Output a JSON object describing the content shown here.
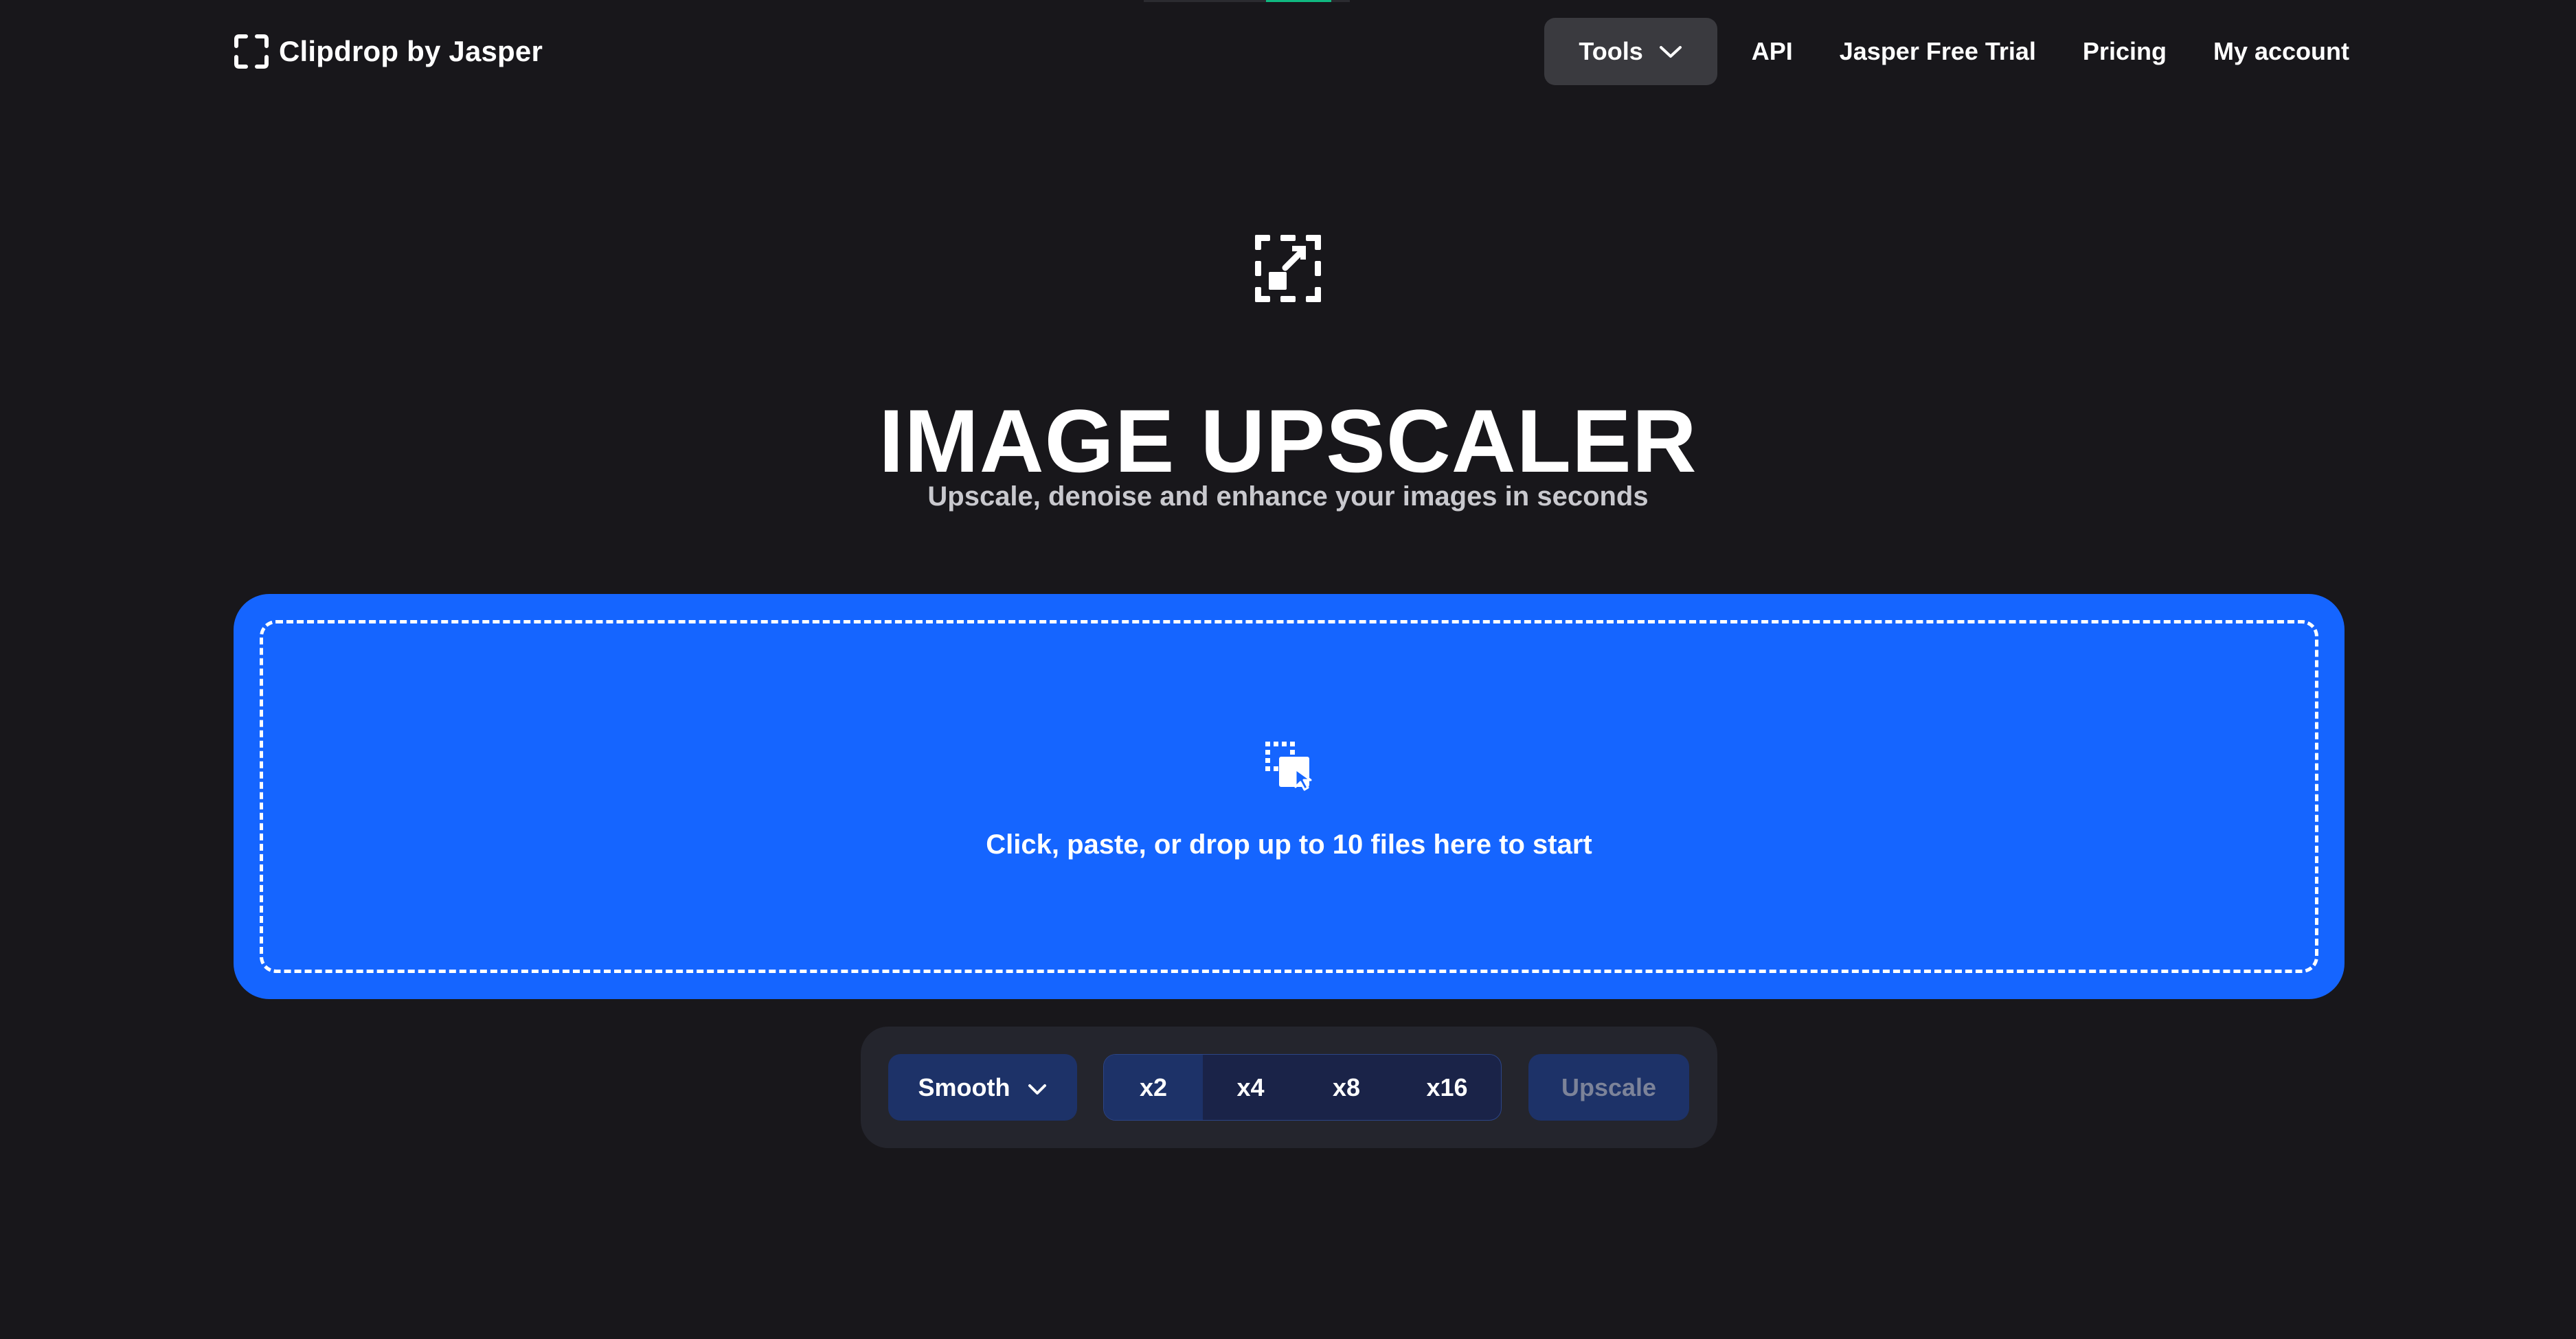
{
  "brand": {
    "name": "Clipdrop by Jasper"
  },
  "nav": {
    "tools_label": "Tools",
    "items": [
      {
        "label": "API"
      },
      {
        "label": "Jasper Free Trial"
      },
      {
        "label": "Pricing"
      },
      {
        "label": "My account"
      }
    ]
  },
  "hero": {
    "title": "IMAGE UPSCALER",
    "subtitle": "Upscale, denoise and enhance your images in seconds"
  },
  "dropzone": {
    "prompt": "Click, paste, or drop up to 10 files here to start"
  },
  "controls": {
    "mode_selected": "Smooth",
    "scales": [
      {
        "label": "x2",
        "active": true
      },
      {
        "label": "x4",
        "active": false
      },
      {
        "label": "x8",
        "active": false
      },
      {
        "label": "x16",
        "active": false
      }
    ],
    "upscale_label": "Upscale"
  },
  "colors": {
    "background": "#18171b",
    "accent_blue": "#1565ff",
    "control_bg": "#24252d",
    "button_navy": "#1d3268",
    "tools_bg": "#3a3a3f",
    "top_accent_green": "#10b981"
  },
  "icons": {
    "brand": "clipdrop-frame-icon",
    "tools_dropdown": "chevron-down-icon",
    "hero": "upscale-arrow-icon",
    "dropzone": "drop-files-icon",
    "mode_dropdown": "chevron-down-icon"
  }
}
